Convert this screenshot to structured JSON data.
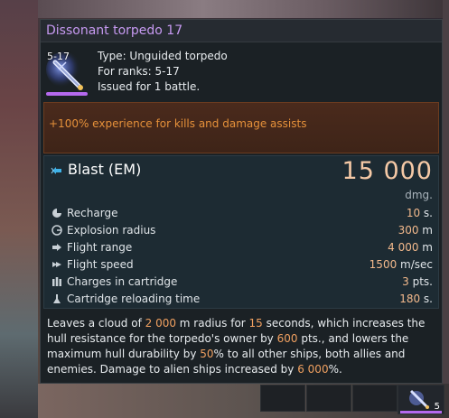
{
  "item": {
    "title": "Dissonant torpedo 17",
    "rank_badge": "5-17",
    "type_line": "Type: Unguided torpedo",
    "ranks_line": "For ranks: 5-17",
    "issued_line": "Issued for 1 battle.",
    "icon": "torpedo-icon"
  },
  "bonus": {
    "text": "+100% experience for kills and damage assists"
  },
  "weapon": {
    "name": "Blast (EM)",
    "icon": "blast-em-icon",
    "damage_value": "15 000",
    "damage_unit": "dmg."
  },
  "stats": [
    {
      "label": "Recharge",
      "value": "10",
      "unit": " s.",
      "icon": "recharge-icon"
    },
    {
      "label": "Explosion radius",
      "value": "300",
      "unit": " m",
      "icon": "radius-icon"
    },
    {
      "label": "Flight range",
      "value": "4 000",
      "unit": " m",
      "icon": "range-icon"
    },
    {
      "label": "Flight speed",
      "value": "1500",
      "unit": " m/sec",
      "icon": "speed-icon"
    },
    {
      "label": "Charges in cartridge",
      "value": "3",
      "unit": " pts.",
      "icon": "charges-icon"
    },
    {
      "label": "Cartridge reloading time",
      "value": "180",
      "unit": " s.",
      "icon": "reload-icon"
    }
  ],
  "description": {
    "t1": "Leaves a cloud of ",
    "v1": "2 000",
    "t2": " m radius for ",
    "v2": "15",
    "t3": " seconds, which increases the hull resistance for the torpedo's owner by ",
    "v3": "600",
    "t4": " pts., and lowers the maximum hull durability by ",
    "v4": "50",
    "t5": "% to all other ships, both allies and enemies. Damage to alien ships increased by ",
    "v5": "6 000",
    "t6": "%."
  },
  "hotbar": {
    "slot_count_label": "5"
  },
  "colors": {
    "title": "#c79af2",
    "bonus_text": "#e6913a",
    "damage_value": "#f5c9a6",
    "stat_value": "#f3b98c",
    "highlight": "#f0a060",
    "rarity_bar": "#b569ee"
  }
}
